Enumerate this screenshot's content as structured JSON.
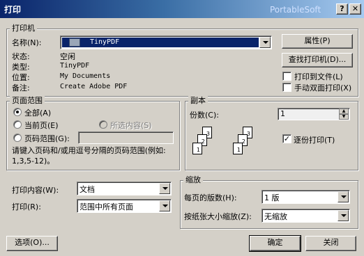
{
  "window": {
    "title": "打印",
    "brand": "PortableSoft",
    "help_btn": "?",
    "close_btn": "✕"
  },
  "printer": {
    "legend": "打印机",
    "name_label": "名称(N):",
    "name_value": "TinyPDF",
    "properties_btn": "属性(P)",
    "find_btn": "查找打印机(D)...",
    "status_label": "状态:",
    "status_value": "空闲",
    "type_label": "类型:",
    "type_value": "TinyPDF",
    "where_label": "位置:",
    "where_value": "My Documents",
    "comment_label": "备注:",
    "comment_value": "Create Adobe PDF",
    "print_to_file": "打印到文件(L)",
    "manual_duplex": "手动双面打印(X)"
  },
  "page_range": {
    "legend": "页面范围",
    "all": "全部(A)",
    "current": "当前页(E)",
    "selection": "所选内容(S)",
    "pages": "页码范围(G):",
    "hint": "请键入页码和/或用逗号分隔的页码范围(例如: 1,3,5-12)。"
  },
  "copies": {
    "legend": "副本",
    "count_label": "份数(C):",
    "count_value": "1",
    "collate": "逐份打印(T)",
    "collate_checked": true
  },
  "print_what": {
    "label": "打印内容(W):",
    "value": "文档"
  },
  "print_option": {
    "label": "打印(R):",
    "value": "范围中所有页面"
  },
  "zoom": {
    "legend": "缩放",
    "pages_per_sheet_label": "每页的版数(H):",
    "pages_per_sheet_value": "1 版",
    "scale_label": "按纸张大小缩放(Z):",
    "scale_value": "无缩放"
  },
  "footer": {
    "options_btn": "选项(O)...",
    "ok_btn": "确定",
    "close_btn": "关闭"
  },
  "collate_pages": {
    "stack1": [
      "3",
      "2",
      "1"
    ],
    "stack2": [
      "3",
      "2",
      "1"
    ]
  },
  "colors": {
    "face": "#d4d0c8",
    "title_start": "#0a246a",
    "title_end": "#a6caf0",
    "selection": "#0a246a"
  }
}
